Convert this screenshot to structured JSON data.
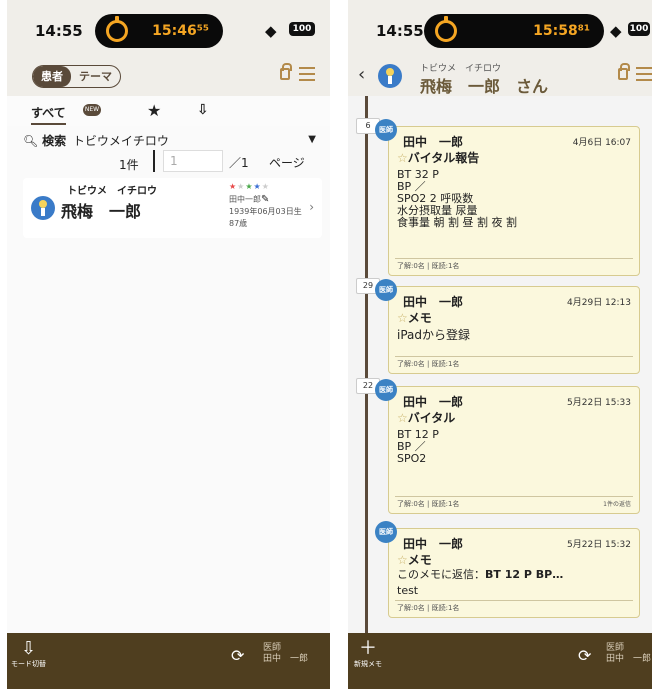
{
  "left": {
    "status": {
      "time": "14:55",
      "elapsed": "15:46⁵⁵",
      "battery": "100"
    },
    "header": {
      "tab_patient": "患者",
      "tab_theme": "テーマ"
    },
    "tabs": {
      "all": "すべて",
      "new_badge": "NEW",
      "favorite": "★",
      "download": "⇩"
    },
    "search": {
      "label": "検索",
      "query": "トビウメイチロウ"
    },
    "pager": {
      "count": "1件",
      "page_value": "1",
      "slash": "／1",
      "page_label": "ページ"
    },
    "patient": {
      "kana": "トビウメ　イチロウ",
      "name": "飛梅　一郎",
      "doctor": "田中一郎",
      "birth": "1939年06月03日生",
      "age": "87歳"
    },
    "footer": {
      "mode_label": "モード切替",
      "role": "医師",
      "user": "田中　一郎"
    }
  },
  "right": {
    "status": {
      "time": "14:55",
      "elapsed": "15:58⁸¹",
      "battery": "100"
    },
    "header": {
      "kana": "トビウメ　イチロウ",
      "name": "飛梅　一郎　さん"
    },
    "memos": [
      {
        "day": "6",
        "badge": "医師",
        "author": "田中　一郎",
        "date": "4月6日 16:07",
        "title": "バイタル報告",
        "body": "BT 32 P\nBP ／\nSPO2 2 呼吸数\n水分摂取量 尿量\n食事量 朝 割 昼 割 夜 割",
        "read": "了解:0名 | 既読:1名"
      },
      {
        "day": "29",
        "badge": "医師",
        "author": "田中　一郎",
        "date": "4月29日 12:13",
        "title": "メモ",
        "body": "iPadから登録",
        "read": "了解:0名 | 既読:1名"
      },
      {
        "day": "22",
        "badge": "医師",
        "author": "田中　一郎",
        "date": "5月22日 15:33",
        "title": "バイタル",
        "body": "BT 12 P\nBP ／\nSPO2",
        "read": "了解:0名 | 既読:1名",
        "reply_count": "1件の返信"
      },
      {
        "badge": "医師",
        "author": "田中　一郎",
        "date": "5月22日 15:32",
        "title": "メモ",
        "reply_prefix": "このメモに返信：",
        "reply_quote": "BT 12 P BP…",
        "body": "test",
        "read": "了解:0名 | 既読:1名"
      }
    ],
    "footer": {
      "new_memo_label": "新規メモ",
      "role": "医師",
      "user": "田中　一郎"
    }
  },
  "colors": {
    "footer_bg": "#4f3e1f",
    "accent": "#f5a623",
    "memo_bg": "#fbf8dd",
    "badge_blue": "#3b82c4"
  }
}
